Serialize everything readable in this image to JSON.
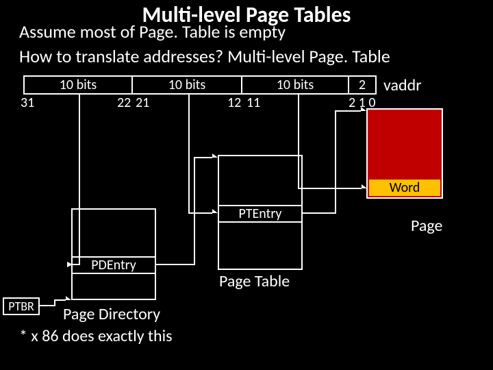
{
  "title": "Multi-level Page Tables",
  "line1": "Assume most of Page. Table is empty",
  "line2": "How to translate addresses?  Multi-level Page. Table",
  "fields": {
    "f1": "10 bits",
    "f2": "10 bits",
    "f3": "10 bits",
    "f4": "2"
  },
  "vaddr": "vaddr",
  "nums": {
    "n31": "31",
    "n22": "22",
    "n21": "21",
    "n12": "12",
    "n11": "11",
    "n210": "2 1 0"
  },
  "word": "Word",
  "page": "Page",
  "ptentry": "PTEntry",
  "pt_label": "Page Table",
  "pdentry": "PDEntry",
  "pd_label": "Page Directory",
  "ptbr": "PTBR",
  "footnote": "* x 86 does exactly this"
}
